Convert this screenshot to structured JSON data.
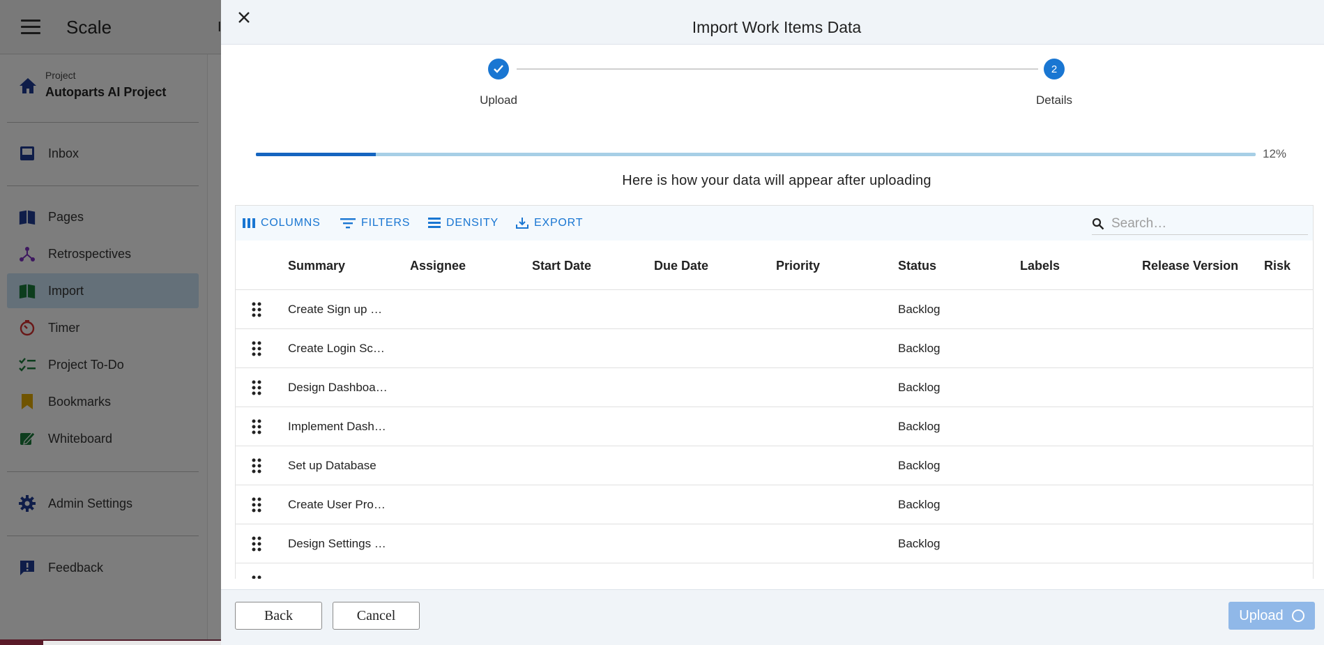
{
  "app": {
    "title": "Scale",
    "topbar_initial": "I",
    "project": {
      "caption": "Project",
      "name": "Autoparts AI Project"
    },
    "nav": [
      {
        "label": "Inbox",
        "icon": "inbox-icon"
      },
      {
        "label": "Pages",
        "icon": "pages-icon"
      },
      {
        "label": "Retrospectives",
        "icon": "retrospectives-icon"
      },
      {
        "label": "Import",
        "icon": "import-icon",
        "active": true
      },
      {
        "label": "Timer",
        "icon": "timer-icon"
      },
      {
        "label": "Project To-Do",
        "icon": "checklist-icon"
      },
      {
        "label": "Bookmarks",
        "icon": "bookmark-icon"
      },
      {
        "label": "Whiteboard",
        "icon": "whiteboard-icon"
      },
      {
        "label": "Admin Settings",
        "icon": "gear-icon"
      },
      {
        "label": "Feedback",
        "icon": "feedback-icon"
      }
    ]
  },
  "dialog": {
    "title": "Import Work Items Data",
    "steps": [
      {
        "label": "Upload",
        "state": "completed"
      },
      {
        "label": "Details",
        "number": "2",
        "state": "active"
      }
    ],
    "progress": {
      "value": 0.12,
      "text": "12%"
    },
    "preview_heading": "Here is how your data will appear after uploading",
    "toolbar": {
      "columns": "COLUMNS",
      "filters": "FILTERS",
      "density": "DENSITY",
      "export": "EXPORT",
      "search_placeholder": "Search…"
    },
    "columns": [
      "Summary",
      "Assignee",
      "Start Date",
      "Due Date",
      "Priority",
      "Status",
      "Labels",
      "Release Version",
      "Risk"
    ],
    "rows": [
      {
        "summary": "Create Sign up …",
        "status": "Backlog"
      },
      {
        "summary": "Create Login Sc…",
        "status": "Backlog"
      },
      {
        "summary": "Design Dashboa…",
        "status": "Backlog"
      },
      {
        "summary": "Implement Dash…",
        "status": "Backlog"
      },
      {
        "summary": "Set up Database",
        "status": "Backlog"
      },
      {
        "summary": "Create User Pro…",
        "status": "Backlog"
      },
      {
        "summary": "Design Settings …",
        "status": "Backlog"
      }
    ],
    "footer": {
      "back": "Back",
      "cancel": "Cancel",
      "upload": "Upload"
    }
  },
  "colors": {
    "accent": "#1976d2",
    "progress_fill": "#1565c0",
    "progress_track": "#a7cfe6",
    "upload_disabled": "#90b8e8",
    "active_nav": "#c8e0f2"
  }
}
